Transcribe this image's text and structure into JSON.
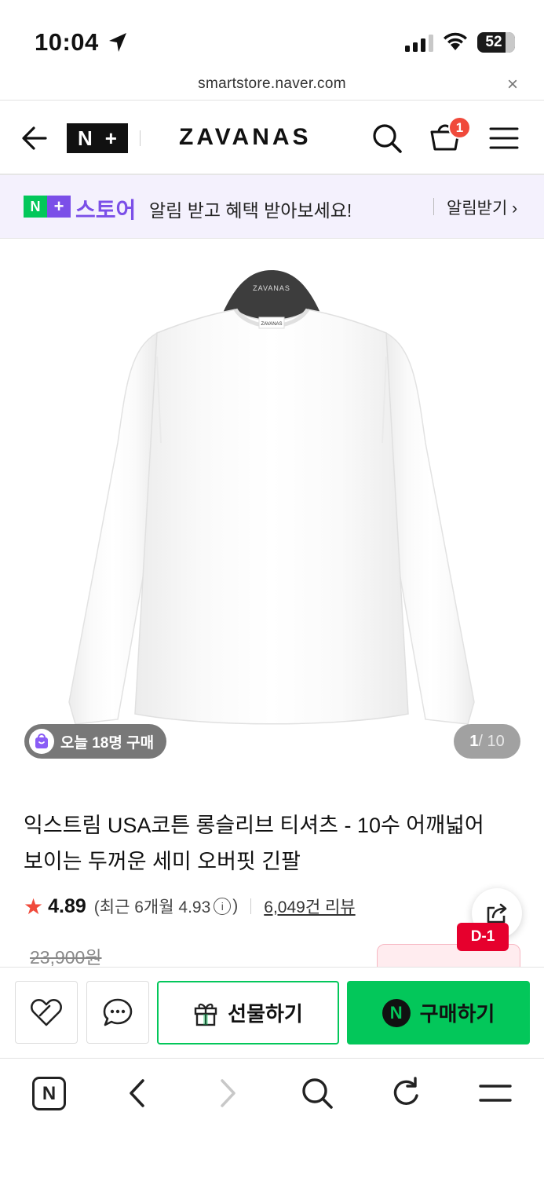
{
  "status_bar": {
    "time": "10:04",
    "battery": "52"
  },
  "browser": {
    "url": "smartstore.naver.com",
    "close_glyph": "×"
  },
  "header": {
    "logo_n": "N",
    "logo_plus": "+",
    "store_name": "ZAVANAS",
    "cart_count": "1"
  },
  "banner": {
    "logo_n": "N",
    "logo_plus": "+",
    "store_word": "스토어",
    "message": "알림 받고 혜택 받아보세요!",
    "cta": "알림받기 ›"
  },
  "product": {
    "buyers_today": "오늘 18명 구매",
    "page_current": "1",
    "page_total": " / 10",
    "title_line1": "익스트림 USA코튼 롱슬리브 티셔츠 - 10수 어깨넓어",
    "title_line2": "보이는 두꺼운 세미 오버핏 긴팔",
    "rating": "4.89",
    "recent_rating_prefix": "(최근 6개월 4.93",
    "recent_rating_suffix": ")",
    "review_count": "6,049건 리뷰",
    "original_price": "23,900원",
    "coupon_badge": "D-1"
  },
  "actions": {
    "gift_label": "선물하기",
    "buy_label": "구매하기",
    "npay_glyph": "N"
  },
  "bottom_nav": {
    "home_glyph": "N"
  },
  "colors": {
    "naver_green": "#03c75a",
    "store_purple": "#7b4fe8",
    "badge_red": "#f04a3b",
    "coupon_red": "#e6002d"
  },
  "icons": [
    "location-arrow-icon",
    "signal-icon",
    "wifi-icon",
    "back-arrow-icon",
    "search-icon",
    "cart-icon",
    "hamburger-menu-icon",
    "shopping-bag-icon",
    "star-icon",
    "info-icon",
    "share-icon",
    "heart-like-icon",
    "talk-bubble-icon",
    "gift-icon",
    "chevron-left-icon",
    "chevron-right-icon",
    "refresh-icon"
  ]
}
